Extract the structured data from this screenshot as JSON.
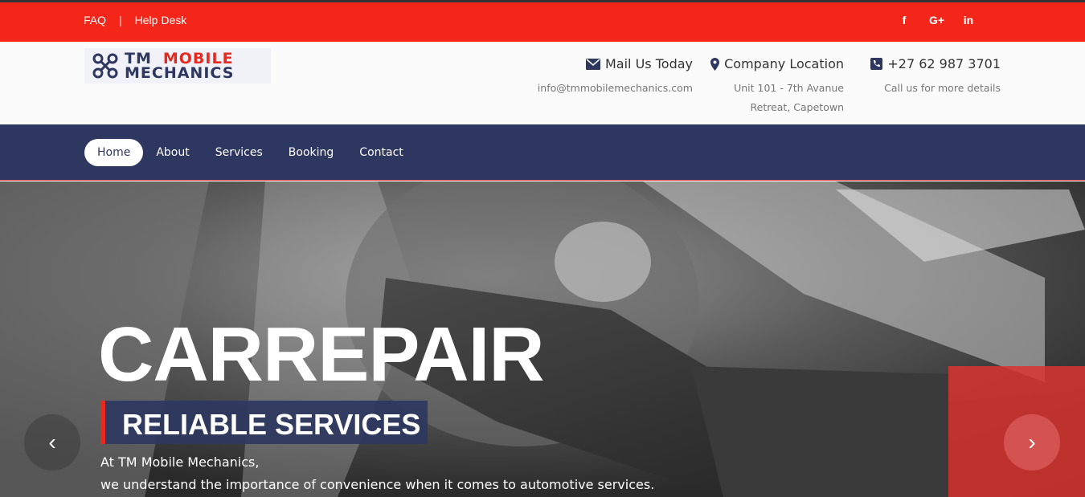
{
  "topbar": {
    "faq": "FAQ",
    "separator": "|",
    "helpdesk": "Help Desk",
    "social": {
      "facebook": "f",
      "googleplus": "G+",
      "linkedin": "in"
    }
  },
  "logo": {
    "line1_a": "TM",
    "line1_b": "MOBILE",
    "line2": "MECHANICS"
  },
  "contact": {
    "mail": {
      "title": "Mail Us Today",
      "line1": "info@tmmobilemechanics.com"
    },
    "location": {
      "title": "Company Location",
      "line1": "Unit 101 - 7th Avanue",
      "line2": "Retreat, Capetown"
    },
    "phone": {
      "title": "+27 62 987 3701",
      "line1": "Call us for more details"
    }
  },
  "nav": {
    "items": [
      {
        "label": "Home"
      },
      {
        "label": "About"
      },
      {
        "label": "Services"
      },
      {
        "label": "Booking"
      },
      {
        "label": "Contact"
      }
    ]
  },
  "hero": {
    "headline": "CARREPAIR",
    "tagline": "RELIABLE SERVICES",
    "desc1": "At TM Mobile Mechanics,",
    "desc2": "we understand the importance of convenience when it comes to automotive services.",
    "prev": "‹",
    "next": "›"
  },
  "colors": {
    "brand_red": "#f4261a",
    "brand_navy": "#2e3760"
  }
}
